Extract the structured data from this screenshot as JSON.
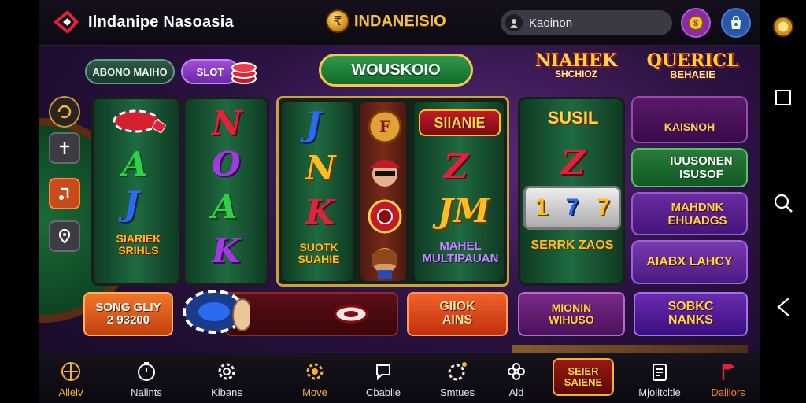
{
  "header": {
    "brand_name": "Ilndanipe Nasoasia",
    "center_brand": "INDANEISIO",
    "search_text": "Kaoinon"
  },
  "pills": {
    "left": "ABONO MAIHO",
    "right": "SLOT"
  },
  "banner": "WOUSKOIO",
  "promos": {
    "top_1_line1": "NIAHEK",
    "top_1_line2": "SHCHIOZ",
    "top_2_line1": "QUERICL",
    "top_2_line2": "BEHAEIE"
  },
  "reels": {
    "col1": [
      "A",
      "J"
    ],
    "col1_badge": "SIARIEK SRIHLS",
    "col2": [
      "N",
      "O",
      "A",
      "K"
    ],
    "col3": [
      "J",
      "N",
      "K"
    ],
    "col3_badge": "SUOTK SUAHIE",
    "col5_badge_top": "SIIANIE",
    "col5": [
      "Z",
      "JM"
    ],
    "col5_badge_bottom": "MAHEL MULTIPAUAN",
    "col6_badge_top": "SUSIL",
    "col6_symbol": "Z",
    "col6_digits": [
      "1",
      "7",
      "7"
    ],
    "col6_badge_bottom": "SERRK ZAOS"
  },
  "right_tiles": [
    "KAISNOH",
    "IUUSONEN ISUSOF",
    "MAHDNK EHUADGS",
    "AIABX LAHCY"
  ],
  "bottom_tiles": {
    "tile_1_line1": "SONG GLIY",
    "tile_1_line2": "2 93200",
    "tile_3_line1": "GIIOK",
    "tile_3_line2": "AINS",
    "tile_4_line1": "MIONIN",
    "tile_4_line2": "WIHUSO",
    "tile_5_line1": "SOBKC",
    "tile_5_line2": "NANKS"
  },
  "nav": {
    "items": [
      {
        "label": "Allelv",
        "icon": "crosshair-icon"
      },
      {
        "label": "Nalints",
        "icon": "stopwatch-icon"
      },
      {
        "label": "Kibans",
        "icon": "gear-icon"
      },
      {
        "label": "Move",
        "icon": "sun-gear-icon"
      },
      {
        "label": "Cbablie",
        "icon": "chat-bubble-icon"
      },
      {
        "label": "Smtues",
        "icon": "gear-badge-icon"
      },
      {
        "label": "Ald",
        "icon": "flower-icon"
      },
      {
        "label": "Mjolitcltle",
        "icon": "clipboard-icon"
      },
      {
        "label": "Dalilors",
        "icon": "flag-icon"
      }
    ],
    "special_line1": "SEIER",
    "special_line2": "SAIENE"
  },
  "colors": {
    "accent_gold": "#f2b23a",
    "felt_green": "#1d6a3a",
    "purple_bg": "#2a1240"
  }
}
